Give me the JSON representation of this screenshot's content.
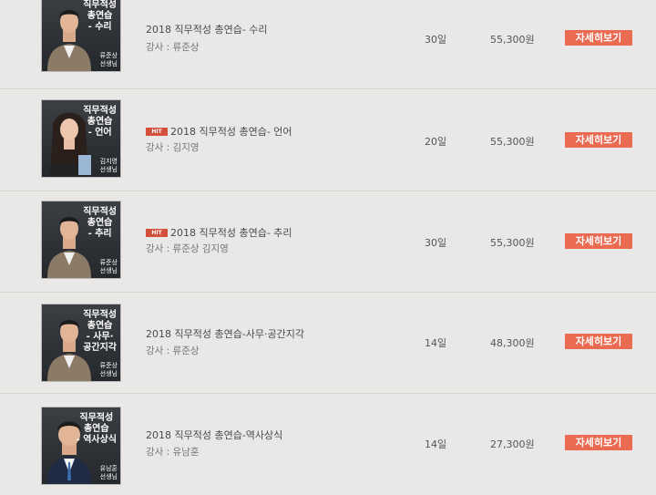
{
  "courses": [
    {
      "thumb_title": "직무적성\n총연습\n- 수리",
      "thumb_teacher": "류준상\n선생님",
      "hit": false,
      "hit_label": "",
      "title": "2018 직무적성 총연습- 수리",
      "instructor": "강사 : 류준상",
      "duration": "30일",
      "price": "55,300원",
      "button_label": "자세히보기"
    },
    {
      "thumb_title": "직무적성\n총연습\n- 언어",
      "thumb_teacher": "김지영\n선생님",
      "hit": true,
      "hit_label": "HIT",
      "title": "2018 직무적성 총연습- 언어",
      "instructor": "강사 : 김지영",
      "duration": "20일",
      "price": "55,300원",
      "button_label": "자세히보기"
    },
    {
      "thumb_title": "직무적성\n총연습\n- 추리",
      "thumb_teacher": "류준상\n선생님",
      "hit": true,
      "hit_label": "HIT",
      "title": "2018 직무적성 총연습- 추리",
      "instructor": "강사 : 류준상 김지영",
      "duration": "30일",
      "price": "55,300원",
      "button_label": "자세히보기"
    },
    {
      "thumb_title": "직무적성\n총연습\n- 사무·\n공간지각",
      "thumb_teacher": "류준상\n선생님",
      "hit": false,
      "hit_label": "",
      "title": "2018 직무적성 총연습-사무·공간지각",
      "instructor": "강사 : 류준상",
      "duration": "14일",
      "price": "48,300원",
      "button_label": "자세히보기"
    },
    {
      "thumb_title": "직무적성\n총연습\n- 역사상식",
      "thumb_teacher": "유남훈\n선생님",
      "hit": false,
      "hit_label": "",
      "title": "2018 직무적성 총연습-역사상식",
      "instructor": "강사 : 유남훈",
      "duration": "14일",
      "price": "27,300원",
      "button_label": "자세히보기"
    }
  ],
  "colors": {
    "button": "#ea6a52",
    "hit_badge": "#d2503c",
    "background": "#e9e8e6"
  }
}
